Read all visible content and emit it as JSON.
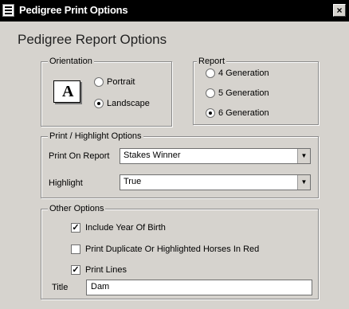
{
  "window": {
    "title": "Pedigree Print Options",
    "close_glyph": "×"
  },
  "page_title": "Pedigree Report Options",
  "orientation": {
    "legend": "Orientation",
    "icon_letter": "A",
    "options": [
      {
        "label": "Portrait",
        "selected": false
      },
      {
        "label": "Landscape",
        "selected": true
      }
    ]
  },
  "report": {
    "legend": "Report",
    "options": [
      {
        "label": "4 Generation",
        "selected": false
      },
      {
        "label": "5 Generation",
        "selected": false
      },
      {
        "label": "6 Generation",
        "selected": true
      }
    ]
  },
  "print_highlight": {
    "legend": "Print / Highlight Options",
    "print_on_report_label": "Print On Report",
    "print_on_report_value": "Stakes Winner",
    "highlight_label": "Highlight",
    "highlight_value": "True"
  },
  "other_options": {
    "legend": "Other Options",
    "checks": [
      {
        "label": "Include Year Of Birth",
        "checked": true
      },
      {
        "label": "Print Duplicate Or Highlighted Horses In Red",
        "checked": false
      },
      {
        "label": "Print Lines",
        "checked": true
      }
    ],
    "title_label": "Title",
    "title_value": "Dam"
  },
  "icons": {
    "app": "pedigree-app-icon",
    "close": "close-icon",
    "orientation": "landscape-page-icon",
    "dropdown": "chevron-down-icon"
  },
  "colors": {
    "window_bg": "#d6d3ce",
    "titlebar_bg": "#000000",
    "titlebar_text": "#ffffff"
  }
}
